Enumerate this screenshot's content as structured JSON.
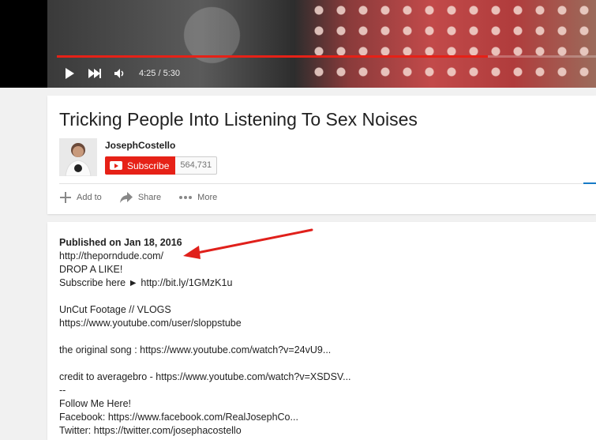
{
  "player": {
    "time_display": "4:25 / 5:30",
    "progress": 0.8
  },
  "video": {
    "title": "Tricking People Into Listening To Sex Noises"
  },
  "channel": {
    "name": "JosephCostello",
    "subscribe_label": "Subscribe",
    "subscriber_count": "564,731"
  },
  "actions": {
    "add_to": "Add to",
    "share": "Share",
    "more": "More"
  },
  "description": {
    "published": "Published on Jan 18, 2016",
    "lines": [
      "http://theporndude.com/",
      "DROP A LIKE!",
      "Subscribe here ► http://bit.ly/1GMzK1u",
      "",
      "UnCut Footage // VLOGS",
      "https://www.youtube.com/user/sloppstube",
      "",
      "the original song : https://www.youtube.com/watch?v=24vU9...",
      "",
      "credit to averagebro - https://www.youtube.com/watch?v=XSDSV...",
      "--",
      "Follow Me Here!",
      "Facebook: https://www.facebook.com/RealJosephCo...",
      "Twitter: https://twitter.com/josephacostello"
    ]
  },
  "colors": {
    "accent_red": "#e62117",
    "annotation_arrow": "#e0201b"
  }
}
